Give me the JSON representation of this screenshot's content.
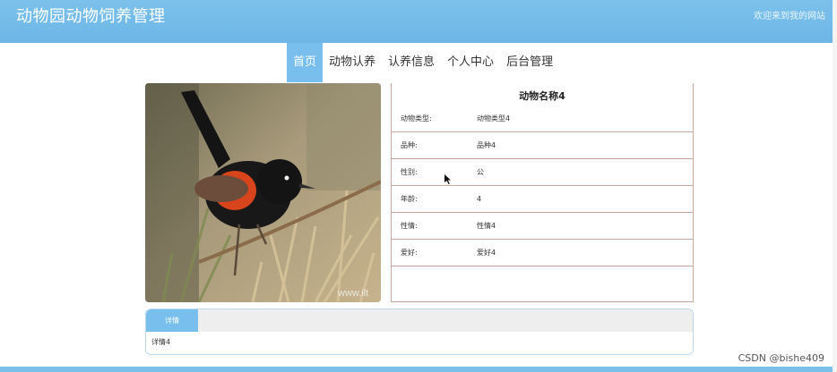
{
  "header": {
    "site_title": "动物园动物饲养管理",
    "welcome": "欢迎来到我的网站"
  },
  "nav": {
    "items": [
      "首页",
      "动物认养",
      "认养信息",
      "个人中心",
      "后台管理"
    ],
    "active_index": 0
  },
  "animal": {
    "name": "动物名称4",
    "fields": [
      {
        "label": "动物类型:",
        "value": "动物类型4"
      },
      {
        "label": "品种:",
        "value": "品种4"
      },
      {
        "label": "性别:",
        "value": "公"
      },
      {
        "label": "年龄:",
        "value": "4"
      },
      {
        "label": "性情:",
        "value": "性情4"
      },
      {
        "label": "爱好:",
        "value": "爱好4"
      }
    ],
    "photo_text": "www.ilt"
  },
  "details": {
    "tab_label": "详情",
    "content": "详情4"
  },
  "watermark": "CSDN @bishe409",
  "colors": {
    "header_bg": "#7cc1ec",
    "accent": "#78bfee",
    "border": "#c9a79c"
  }
}
